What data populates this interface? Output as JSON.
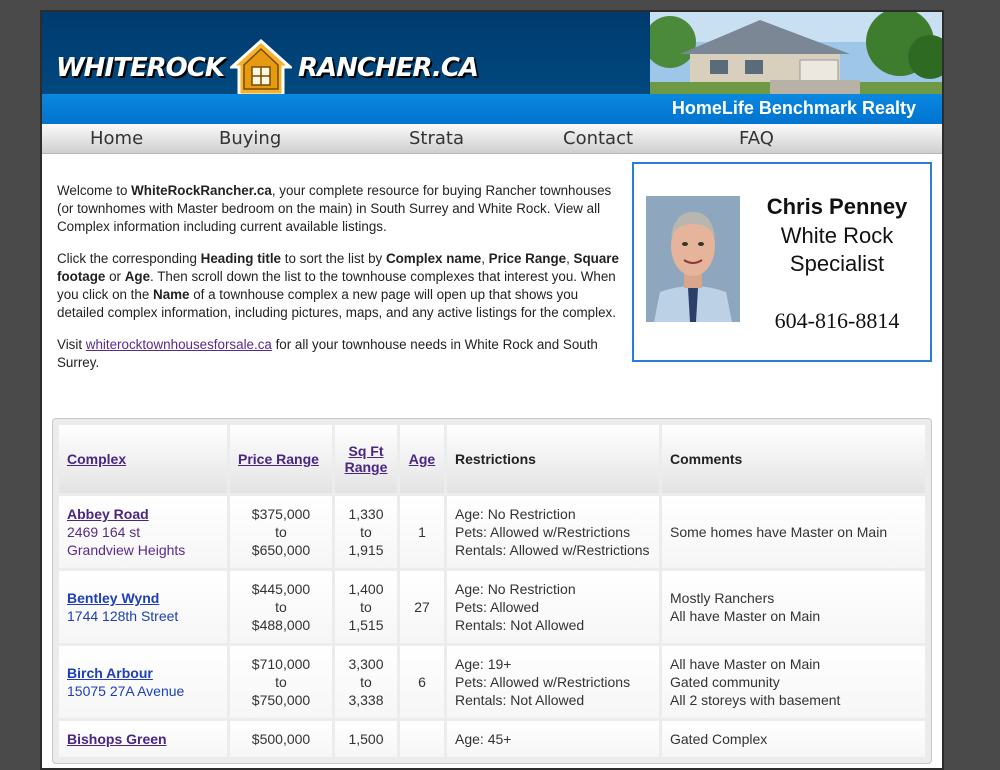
{
  "header": {
    "logo_left": "WHITEROCK",
    "logo_right": "RANCHER.CA",
    "realty": "HomeLife Benchmark Realty"
  },
  "nav": {
    "items": [
      "Home",
      "Buying",
      "Strata",
      "Contact",
      "FAQ"
    ]
  },
  "intro": {
    "p1_a": "Welcome to ",
    "p1_b": "WhiteRockRancher.ca",
    "p1_c": ", your complete resource for buying Rancher townhouses (or townhomes with Master bedroom on the main) in South Surrey and White Rock. View all Complex information including current available listings.",
    "p2_a": "Click the corresponding ",
    "p2_b": "Heading title",
    "p2_c": " to sort the list by ",
    "p2_d": "Complex name",
    "p2_e": ", ",
    "p2_f": "Price Range",
    "p2_g": ", ",
    "p2_h": "Square footage",
    "p2_i": " or ",
    "p2_j": "Age",
    "p2_k": ". Then scroll down the list to the townhouse complexes that interest you.  When you click on the ",
    "p2_l": "Name",
    "p2_m": " of a townhouse complex a new page will open up that shows you detailed complex information, including pictures, maps, and any active listings for the complex.",
    "p3_a": "Visit ",
    "p3_link": "whiterocktownhousesforsale.ca",
    "p3_b": " for all your townhouse needs in White Rock and South Surrey."
  },
  "card": {
    "name": "Chris Penney",
    "title_line1": "White Rock",
    "title_line2": "Specialist",
    "phone": "604-816-8814"
  },
  "table": {
    "headers": {
      "complex": "Complex",
      "price": "Price Range",
      "sqft_1": "Sq Ft",
      "sqft_2": "Range",
      "age": "Age",
      "restrictions": "Restrictions",
      "comments": "Comments"
    },
    "rows": [
      {
        "name": "Abbey Road",
        "address_1": "2469 164 st",
        "address_2": "Grandview Heights",
        "price_low": "$375,000",
        "to": "to",
        "price_high": "$650,000",
        "sqft_low": "1,330",
        "sqft_high": "1,915",
        "age": "1",
        "r_age": "Age: No Restriction",
        "r_pets": "Pets: Allowed w/Restrictions",
        "r_rentals": "Rentals: Allowed w/Restrictions",
        "c1": "Some homes have Master on Main",
        "c2": "",
        "c3": ""
      },
      {
        "name": "Bentley Wynd",
        "address_1": "1744 128th Street",
        "address_2": "",
        "price_low": "$445,000",
        "to": "to",
        "price_high": "$488,000",
        "sqft_low": "1,400",
        "sqft_high": "1,515",
        "age": "27",
        "r_age": "Age: No Restriction",
        "r_pets": "Pets: Allowed",
        "r_rentals": "Rentals: Not Allowed",
        "c1": "Mostly Ranchers",
        "c2": "All have Master on Main",
        "c3": ""
      },
      {
        "name": "Birch Arbour",
        "address_1": "15075 27A Avenue",
        "address_2": "",
        "price_low": "$710,000",
        "to": "to",
        "price_high": "$750,000",
        "sqft_low": "3,300",
        "sqft_high": "3,338",
        "age": "6",
        "r_age": "Age: 19+",
        "r_pets": "Pets: Allowed w/Restrictions",
        "r_rentals": "Rentals: Not Allowed",
        "c1": "All have Master on Main",
        "c2": "Gated community",
        "c3": "All 2 storeys with basement"
      },
      {
        "name": "Bishops Green",
        "address_1": "",
        "address_2": "",
        "price_low": "$500,000",
        "to": "",
        "price_high": "",
        "sqft_low": "1,500",
        "sqft_high": "",
        "age": "",
        "r_age": "Age: 45+",
        "r_pets": "",
        "r_rentals": "",
        "c1": "Gated Complex",
        "c2": "",
        "c3": ""
      }
    ]
  }
}
